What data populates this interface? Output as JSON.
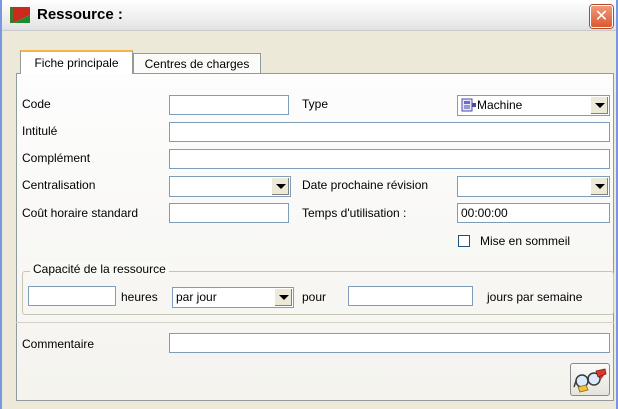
{
  "window": {
    "title": "Ressource :",
    "close_glyph": "✕"
  },
  "tabs": [
    {
      "label": "Fiche principale",
      "active": true
    },
    {
      "label": "Centres de charges",
      "active": false
    }
  ],
  "form": {
    "code_label": "Code",
    "code_value": "",
    "type_label": "Type",
    "type_value": "Machine",
    "type_icon": "machine-icon",
    "intitule_label": "Intitulé",
    "intitule_value": "",
    "complement_label": "Complément",
    "complement_value": "",
    "centralisation_label": "Centralisation",
    "centralisation_value": "",
    "date_revision_label": "Date prochaine révision",
    "date_revision_value": "",
    "cout_label": "Coût horaire standard",
    "cout_value": "",
    "temps_label": "Temps d'utilisation :",
    "temps_value": "00:00:00",
    "mise_sommeil_label": "Mise en sommeil",
    "mise_sommeil_checked": false
  },
  "capacite": {
    "group_label": "Capacité de la ressource",
    "heures_value": "",
    "heures_label": "heures",
    "periode_value": "par jour",
    "pour_label": "pour",
    "jours_value": "",
    "jours_label": "jours par semaine"
  },
  "commentaire": {
    "label": "Commentaire",
    "value": ""
  },
  "action_button_icon": "search-glasses-icon"
}
